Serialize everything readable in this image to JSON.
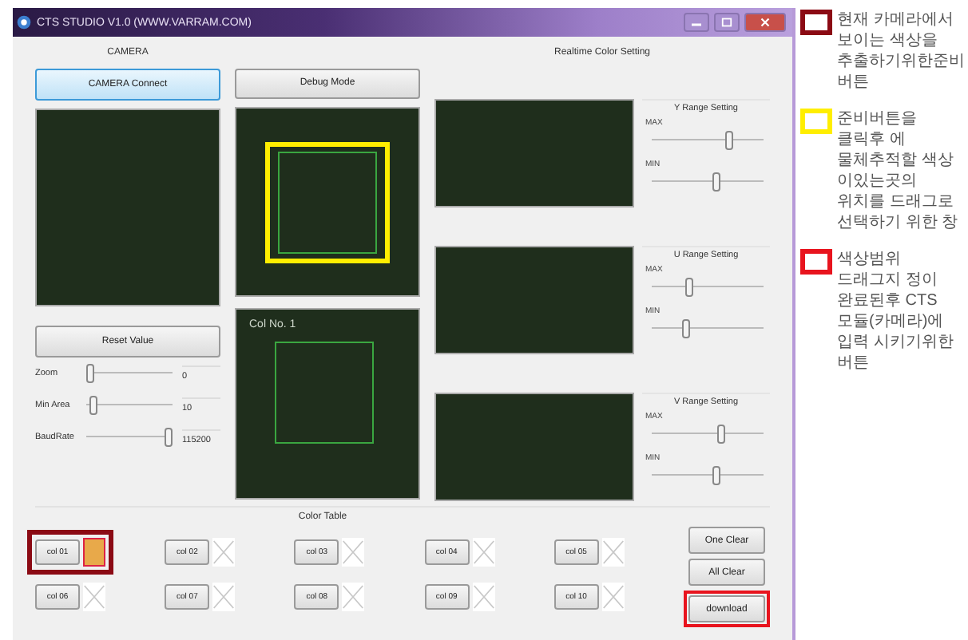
{
  "window": {
    "title": "CTS STUDIO V1.0 (WWW.VARRAM.COM)"
  },
  "camera": {
    "label": "CAMERA",
    "connect_button": {
      "label": "CAMERA Connect",
      "focused": true
    },
    "reset_button": {
      "label": "Reset Value",
      "focused": false
    },
    "sliders": [
      {
        "label": "Zoom",
        "level": 0,
        "value": "0"
      },
      {
        "label": "Min Area",
        "level": 0.05,
        "value": "10"
      },
      {
        "label": "BaudRate",
        "level": 1,
        "value": "115200"
      }
    ]
  },
  "debug": {
    "button": {
      "label": "Debug Mode",
      "focused": false
    },
    "selection": {
      "highlight": {
        "color": "#ffee00"
      }
    },
    "col_label": "Col No. 1"
  },
  "realtime": {
    "title": "Realtime Color Setting",
    "ranges": [
      {
        "title": "Y Range Setting",
        "sliders": [
          {
            "label": "MAX",
            "level": 0.7
          },
          {
            "label": "MIN",
            "level": 0.59
          }
        ]
      },
      {
        "title": "U Range Setting",
        "sliders": [
          {
            "label": "MAX",
            "level": 0.33
          },
          {
            "label": "MIN",
            "level": 0.29
          }
        ]
      },
      {
        "title": "V Range Setting",
        "sliders": [
          {
            "label": "MAX",
            "level": 0.63
          },
          {
            "label": "MIN",
            "level": 0.59
          }
        ]
      }
    ]
  },
  "color_table": {
    "title": "Color Table",
    "colors": [
      {
        "label": "col 01",
        "filled": true,
        "color": "#e8a94a",
        "highlight": {
          "color": "#8b0a14"
        }
      },
      {
        "label": "col 02",
        "filled": false
      },
      {
        "label": "col 03",
        "filled": false
      },
      {
        "label": "col 04",
        "filled": false
      },
      {
        "label": "col 05",
        "filled": false
      },
      {
        "label": "col 06",
        "filled": false
      },
      {
        "label": "col 07",
        "filled": false
      },
      {
        "label": "col 08",
        "filled": false
      },
      {
        "label": "col 09",
        "filled": false
      },
      {
        "label": "col 10",
        "filled": false
      }
    ],
    "actions": [
      {
        "label": "One Clear"
      },
      {
        "label": "All Clear"
      },
      {
        "label": "download",
        "highlight": {
          "color": "#e8141e"
        }
      }
    ]
  },
  "notes": [
    {
      "color": "#8b0a14",
      "text": "현재 카메라에서 보이는 색상을 추출하기위한준비 버튼"
    },
    {
      "color": "#ffee00",
      "text": "준비버튼을 클릭후 에 물체추적할 색상 이있는곳의 위치를 드래그로 선택하기 위한 창"
    },
    {
      "color": "#e8141e",
      "text": "색상범위 드래그지 정이 완료된후 CTS 모듈(카메라)에 입력 시키기위한 버튼"
    }
  ]
}
